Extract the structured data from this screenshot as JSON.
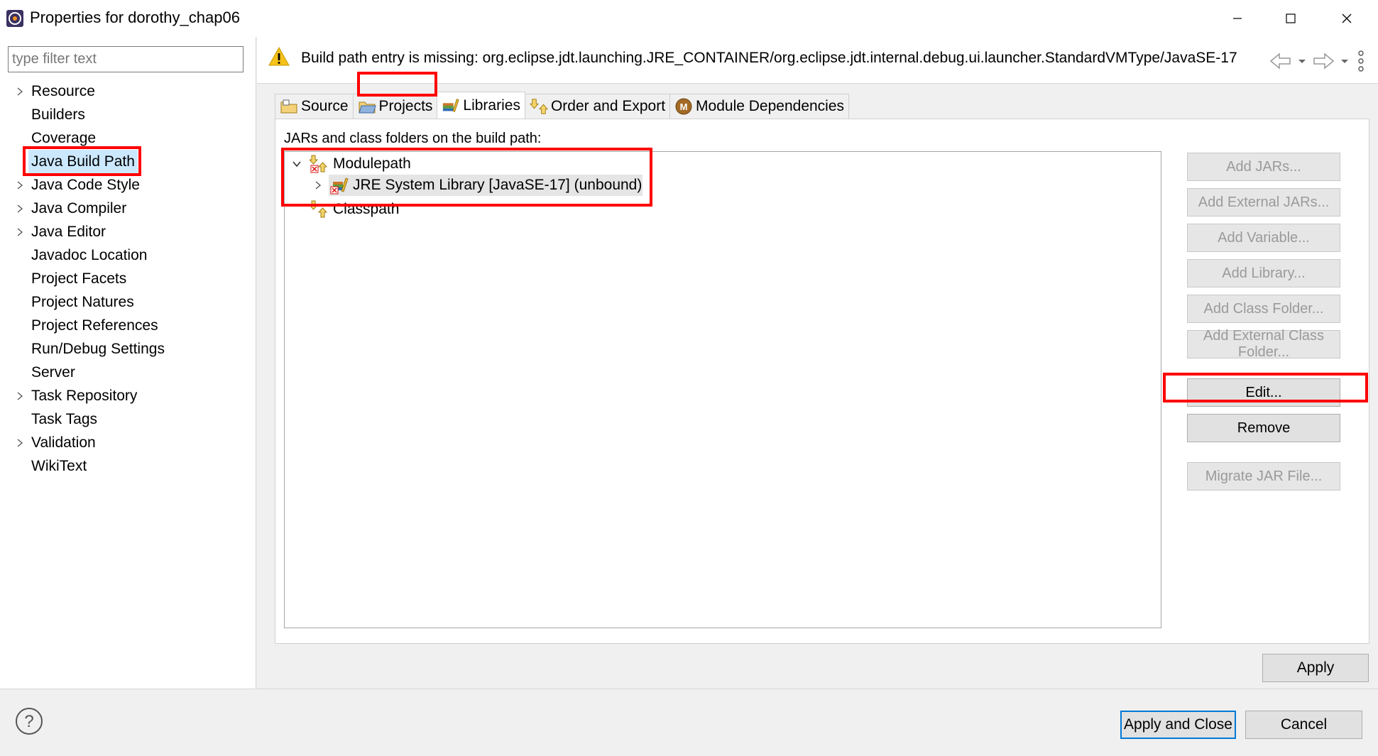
{
  "window": {
    "title": "Properties for dorothy_chap06",
    "controls": [
      "minimize",
      "maximize",
      "close"
    ]
  },
  "filter": {
    "placeholder": "type filter text",
    "value": ""
  },
  "nav_tree": {
    "items": [
      {
        "label": "Resource",
        "expandable": true
      },
      {
        "label": "Builders",
        "expandable": false
      },
      {
        "label": "Coverage",
        "expandable": false
      },
      {
        "label": "Java Build Path",
        "expandable": false,
        "selected": true
      },
      {
        "label": "Java Code Style",
        "expandable": true
      },
      {
        "label": "Java Compiler",
        "expandable": true
      },
      {
        "label": "Java Editor",
        "expandable": true
      },
      {
        "label": "Javadoc Location",
        "expandable": false
      },
      {
        "label": "Project Facets",
        "expandable": false
      },
      {
        "label": "Project Natures",
        "expandable": false
      },
      {
        "label": "Project References",
        "expandable": false
      },
      {
        "label": "Run/Debug Settings",
        "expandable": false
      },
      {
        "label": "Server",
        "expandable": false
      },
      {
        "label": "Task Repository",
        "expandable": true
      },
      {
        "label": "Task Tags",
        "expandable": false
      },
      {
        "label": "Validation",
        "expandable": true
      },
      {
        "label": "WikiText",
        "expandable": false
      }
    ]
  },
  "header": {
    "message": "Build path entry is missing: org.eclipse.jdt.launching.JRE_CONTAINER/org.eclipse.jdt.internal.debug.ui.launcher.StandardVMType/JavaSE-17"
  },
  "tabs": [
    {
      "label": "Source",
      "icon": "source-folder-icon"
    },
    {
      "label": "Projects",
      "icon": "projects-icon"
    },
    {
      "label": "Libraries",
      "icon": "libraries-icon",
      "active": true
    },
    {
      "label": "Order and Export",
      "icon": "order-export-icon"
    },
    {
      "label": "Module Dependencies",
      "icon": "module-icon"
    }
  ],
  "libraries": {
    "caption": "JARs and class folders on the build path:",
    "entries": {
      "modulepath": "Modulepath",
      "jre": "JRE System Library [JavaSE-17] (unbound)",
      "classpath": "Classpath"
    },
    "buttons": {
      "add_jars": "Add JARs...",
      "add_external_jars": "Add External JARs...",
      "add_variable": "Add Variable...",
      "add_library": "Add Library...",
      "add_class_folder": "Add Class Folder...",
      "add_external_class_folder": "Add External Class Folder...",
      "edit": "Edit...",
      "remove": "Remove",
      "migrate_jar": "Migrate JAR File..."
    }
  },
  "footer": {
    "apply": "Apply",
    "apply_and_close": "Apply and Close",
    "cancel": "Cancel"
  },
  "colors": {
    "highlight_box": "#ff0000",
    "selection": "#cce8ff",
    "default_button_border": "#0078d7",
    "warning": "#f5c21b"
  }
}
